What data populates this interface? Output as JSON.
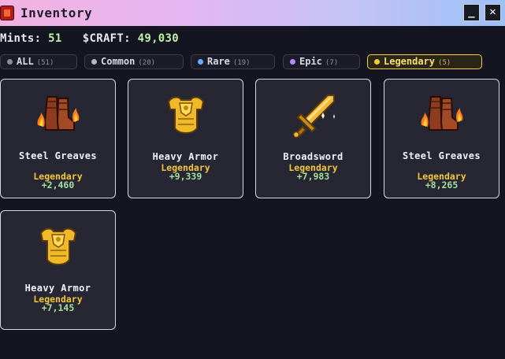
{
  "window": {
    "title": "Inventory",
    "minimize_label": "_",
    "close_label": "✕"
  },
  "stats": {
    "mints_label": "Mints:",
    "mints_value": "51",
    "craft_label": "$CRAFT:",
    "craft_value": "49,030"
  },
  "filters": [
    {
      "label": "ALL",
      "count": "(51)",
      "dot_color": "#8d8d99",
      "active": false
    },
    {
      "label": "Common",
      "count": "(20)",
      "dot_color": "#b8b8c2",
      "active": false
    },
    {
      "label": "Rare",
      "count": "(19)",
      "dot_color": "#6aa9ff",
      "active": false
    },
    {
      "label": "Epic",
      "count": "(7)",
      "dot_color": "#b58cff",
      "active": false
    },
    {
      "label": "Legendary",
      "count": "(5)",
      "dot_color": "#f3cd2e",
      "active": true
    }
  ],
  "items": [
    {
      "name": "Steel Greaves",
      "rarity": "Legendary",
      "points": "+2,460",
      "icon": "flaming-greaves-icon"
    },
    {
      "name": "Heavy Armor",
      "rarity": "Legendary",
      "points": "+9,339",
      "icon": "golden-armor-icon"
    },
    {
      "name": "Broadsword",
      "rarity": "Legendary",
      "points": "+7,983",
      "icon": "golden-sword-icon"
    },
    {
      "name": "Steel Greaves",
      "rarity": "Legendary",
      "points": "+8,265",
      "icon": "flaming-greaves-icon"
    },
    {
      "name": "Heavy Armor",
      "rarity": "Legendary",
      "points": "+7,145",
      "icon": "golden-armor-icon"
    }
  ],
  "colors": {
    "accent": "#f0cf3a",
    "legendary": "#f3c63a",
    "points": "#a6df9e",
    "background": "#151521"
  }
}
